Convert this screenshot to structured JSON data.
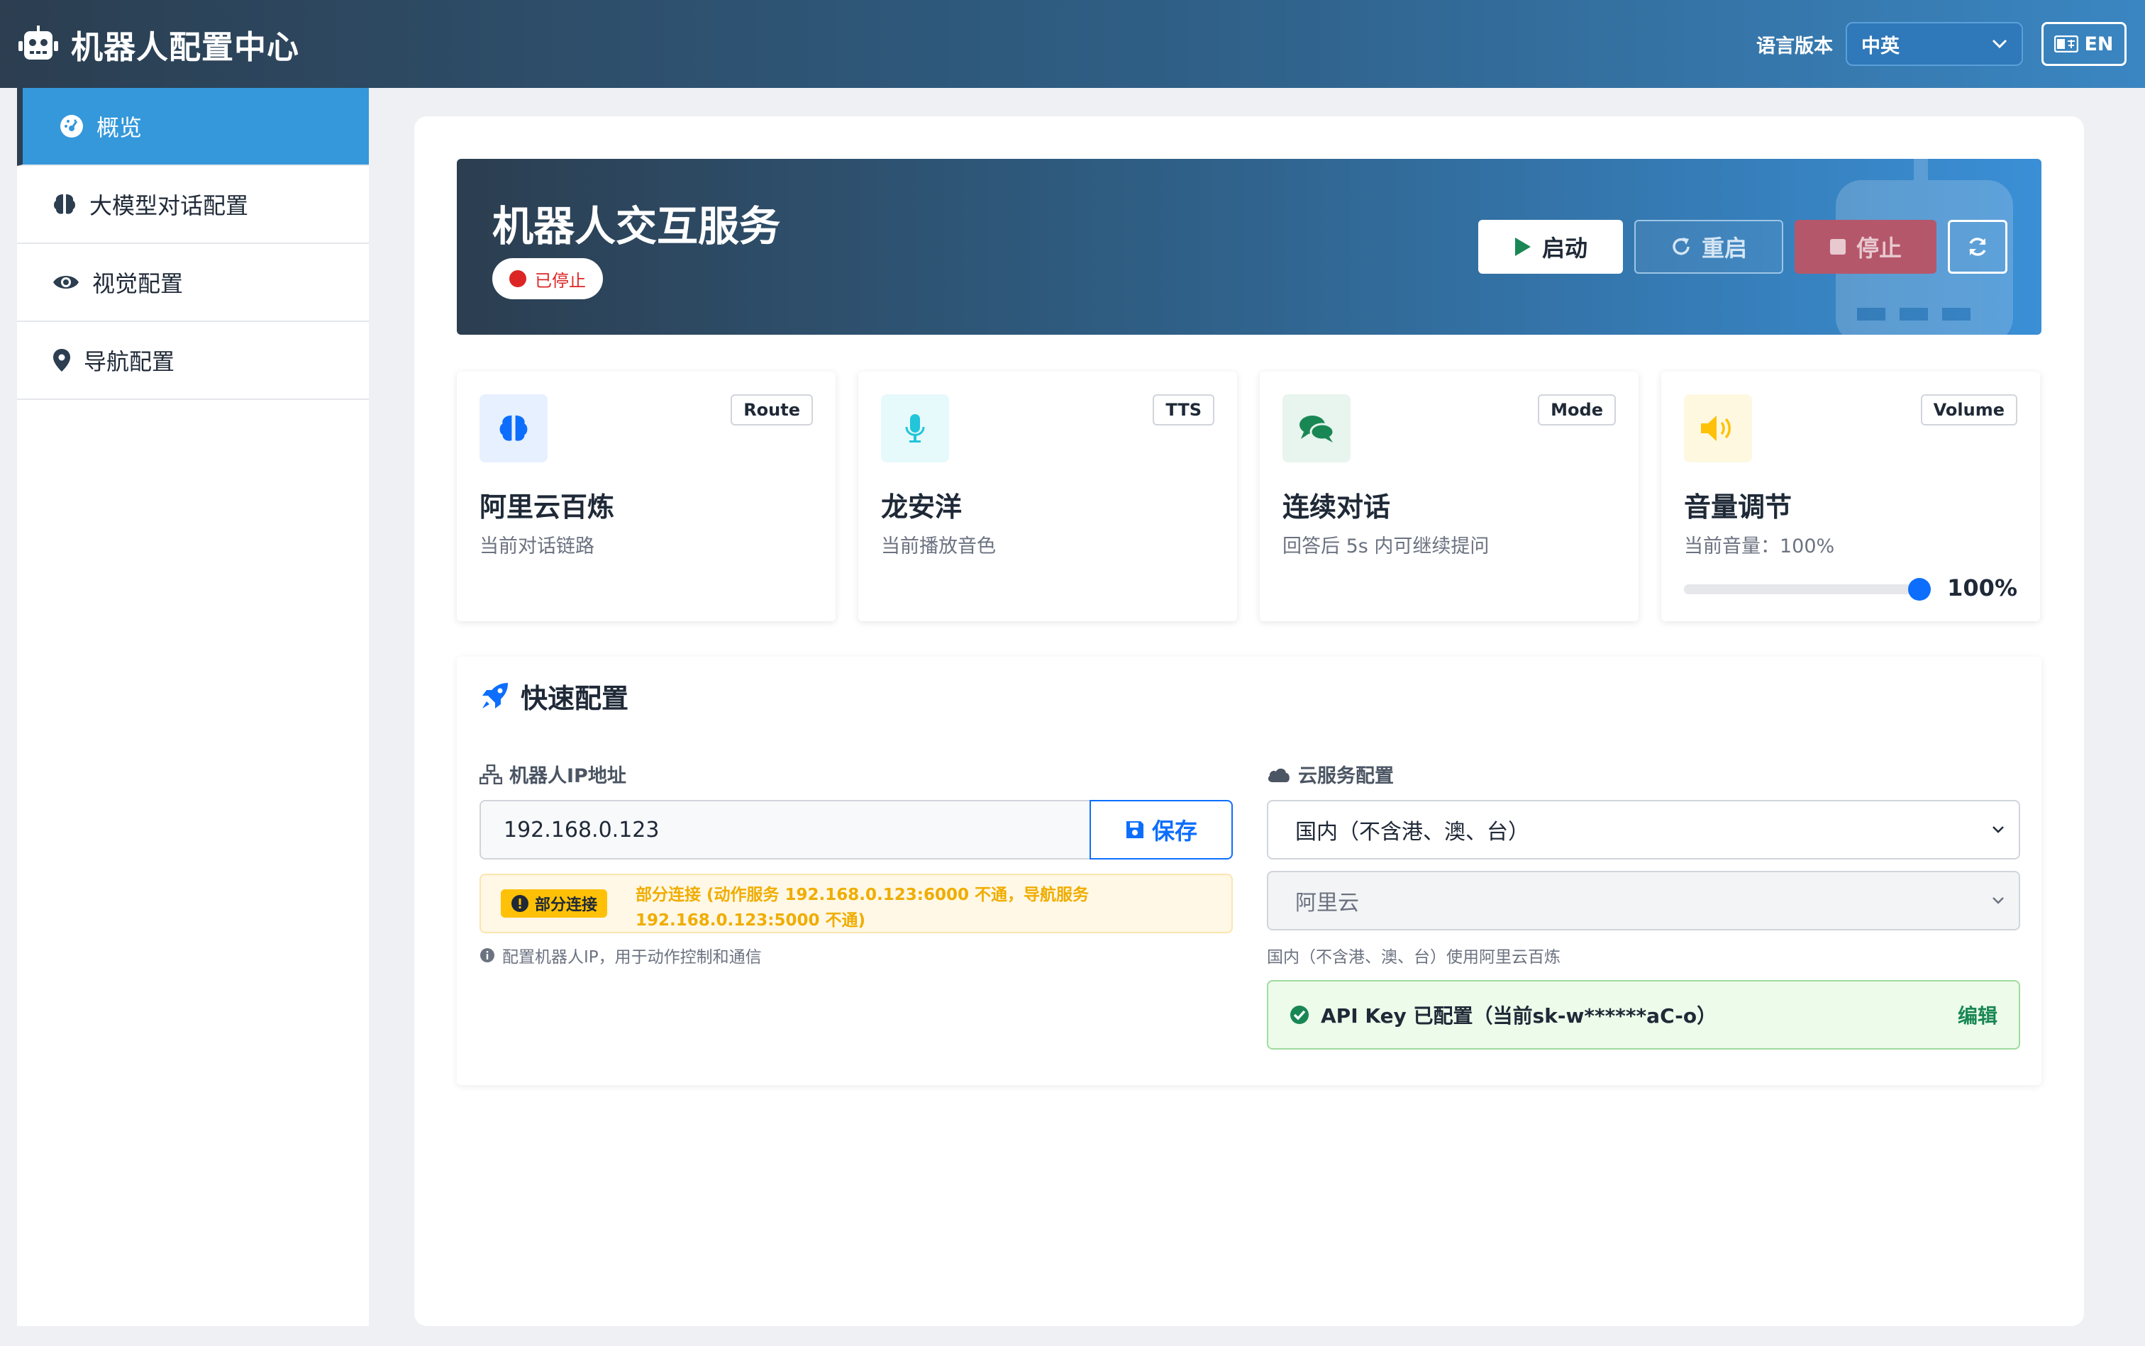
{
  "app": {
    "title": "机器人配置中心"
  },
  "header": {
    "lang_label": "语言版本",
    "lang_value": "中英",
    "lang_button": "EN"
  },
  "sidebar": {
    "items": [
      {
        "label": "概览",
        "icon": "dashboard-icon",
        "active": true
      },
      {
        "label": "大模型对话配置",
        "icon": "brain-icon"
      },
      {
        "label": "视觉配置",
        "icon": "eye-icon"
      },
      {
        "label": "导航配置",
        "icon": "map-pin-icon"
      }
    ]
  },
  "hero": {
    "title": "机器人交互服务",
    "status": "已停止",
    "buttons": {
      "start": "启动",
      "restart": "重启",
      "stop": "停止"
    }
  },
  "cards": [
    {
      "tag": "Route",
      "title": "阿里云百炼",
      "sub": "当前对话链路",
      "icon": "brain-icon",
      "color": "#0d6efd",
      "bg": "#e7f0ff"
    },
    {
      "tag": "TTS",
      "title": "龙安洋",
      "sub": "当前播放音色",
      "icon": "microphone-icon",
      "color": "#22c5d9",
      "bg": "#e6f9fb"
    },
    {
      "tag": "Mode",
      "title": "连续对话",
      "sub": "回答后 5s 内可继续提问",
      "icon": "chat-icon",
      "color": "#198754",
      "bg": "#e8f4ee"
    },
    {
      "tag": "Volume",
      "title": "音量调节",
      "sub": "当前音量：100%",
      "icon": "volume-icon",
      "color": "#ffc107",
      "bg": "#fff8e1",
      "volume": 100,
      "volume_text": "100%"
    }
  ],
  "quick": {
    "title": "快速配置",
    "ip_label": "机器人IP地址",
    "ip_value": "192.168.0.123",
    "save": "保存",
    "warn_badge": "部分连接",
    "warn_text": "部分连接 (动作服务 192.168.0.123:6000 不通，导航服务 192.168.0.123:5000 不通)",
    "ip_hint": "配置机器人IP，用于动作控制和通信",
    "cloud_label": "云服务配置",
    "region_value": "国内（不含港、澳、台）",
    "provider_value": "阿里云",
    "cloud_hint": "国内（不含港、澳、台）使用阿里云百炼",
    "api_text": "API Key 已配置（当前sk-w******aC-o）",
    "api_edit": "编辑"
  }
}
